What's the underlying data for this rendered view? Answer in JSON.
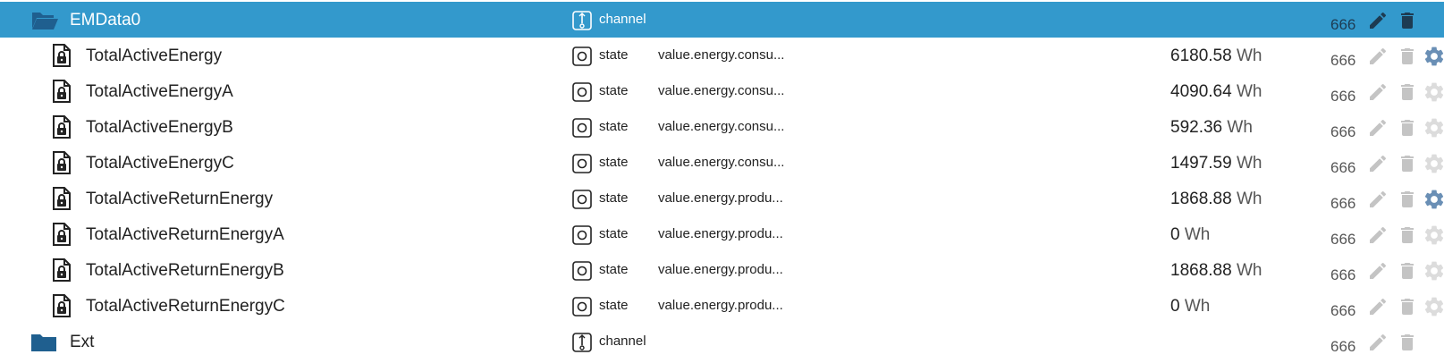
{
  "rows": [
    {
      "name": "EMData0",
      "kind": "folder-open",
      "type": "channel",
      "role": "",
      "value": "",
      "unit": "",
      "acl": "666",
      "selected": true,
      "config": ""
    },
    {
      "name": "TotalActiveEnergy",
      "kind": "state",
      "type": "state",
      "role": "value.energy.consu...",
      "value": "6180.58",
      "unit": "Wh",
      "acl": "666",
      "config": "active"
    },
    {
      "name": "TotalActiveEnergyA",
      "kind": "state",
      "type": "state",
      "role": "value.energy.consu...",
      "value": "4090.64",
      "unit": "Wh",
      "acl": "666",
      "config": "inactive"
    },
    {
      "name": "TotalActiveEnergyB",
      "kind": "state",
      "type": "state",
      "role": "value.energy.consu...",
      "value": "592.36",
      "unit": "Wh",
      "acl": "666",
      "config": "inactive"
    },
    {
      "name": "TotalActiveEnergyC",
      "kind": "state",
      "type": "state",
      "role": "value.energy.consu...",
      "value": "1497.59",
      "unit": "Wh",
      "acl": "666",
      "config": "inactive"
    },
    {
      "name": "TotalActiveReturnEnergy",
      "kind": "state",
      "type": "state",
      "role": "value.energy.produ...",
      "value": "1868.88",
      "unit": "Wh",
      "acl": "666",
      "config": "active"
    },
    {
      "name": "TotalActiveReturnEnergyA",
      "kind": "state",
      "type": "state",
      "role": "value.energy.produ...",
      "value": "0",
      "unit": "Wh",
      "acl": "666",
      "config": "inactive"
    },
    {
      "name": "TotalActiveReturnEnergyB",
      "kind": "state",
      "type": "state",
      "role": "value.energy.produ...",
      "value": "1868.88",
      "unit": "Wh",
      "acl": "666",
      "config": "inactive"
    },
    {
      "name": "TotalActiveReturnEnergyC",
      "kind": "state",
      "type": "state",
      "role": "value.energy.produ...",
      "value": "0",
      "unit": "Wh",
      "acl": "666",
      "config": "inactive"
    },
    {
      "name": "Ext",
      "kind": "folder-closed",
      "type": "channel",
      "role": "",
      "value": "",
      "unit": "",
      "acl": "666",
      "config": ""
    }
  ],
  "icons": {
    "folder_open": "folder-open-icon",
    "folder_closed": "folder-icon",
    "state_file": "locked-file-icon",
    "channel_type": "channel-icon",
    "state_type": "state-icon",
    "edit": "pencil-icon",
    "delete": "trash-icon",
    "config": "gear-icon"
  },
  "colors": {
    "selected_bg": "#3399cc",
    "folder": "#1f5f8f",
    "action_active": "#6a8fb5",
    "action_inactive": "#c4c4c4",
    "selected_action": "#1d3b52"
  }
}
